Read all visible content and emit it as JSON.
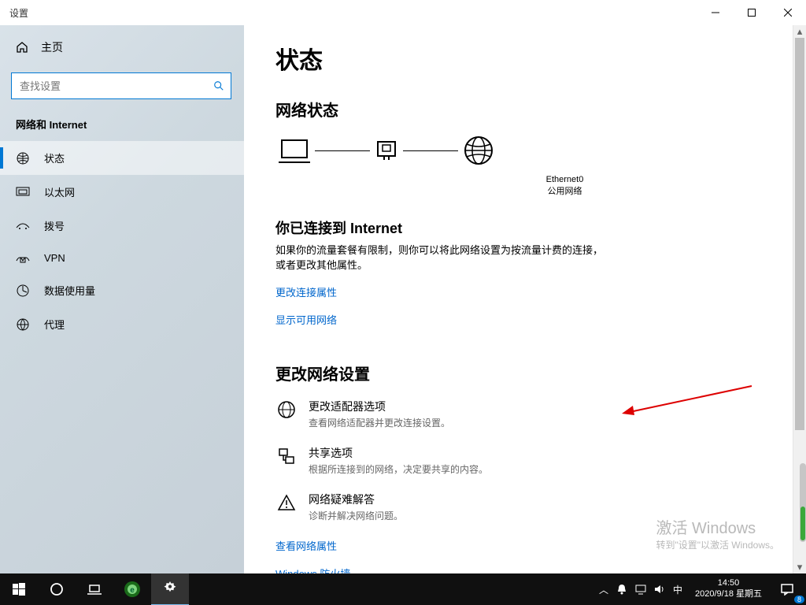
{
  "window_title": "设置",
  "sidebar": {
    "home": "主页",
    "search_placeholder": "查找设置",
    "category": "网络和 Internet",
    "items": [
      {
        "label": "状态"
      },
      {
        "label": "以太网"
      },
      {
        "label": "拨号"
      },
      {
        "label": "VPN"
      },
      {
        "label": "数据使用量"
      },
      {
        "label": "代理"
      }
    ]
  },
  "content": {
    "h1": "状态",
    "h2": "网络状态",
    "diagram": {
      "if_name": "Ethernet0",
      "if_type": "公用网络"
    },
    "connected_title": "你已连接到 Internet",
    "connected_desc": "如果你的流量套餐有限制，则你可以将此网络设置为按流量计费的连接，或者更改其他属性。",
    "link_change_conn": "更改连接属性",
    "link_show_networks": "显示可用网络",
    "h2b": "更改网络设置",
    "opts": [
      {
        "t1": "更改适配器选项",
        "t2": "查看网络适配器并更改连接设置。"
      },
      {
        "t1": "共享选项",
        "t2": "根据所连接到的网络，决定要共享的内容。"
      },
      {
        "t1": "网络疑难解答",
        "t2": "诊断并解决网络问题。"
      }
    ],
    "link_props": "查看网络属性",
    "link_firewall": "Windows 防火墙"
  },
  "watermark": {
    "w1": "激活 Windows",
    "w2": "转到\"设置\"以激活 Windows。"
  },
  "taskbar": {
    "ime": "中",
    "time": "14:50",
    "date": "2020/9/18 星期五",
    "badge": "8"
  }
}
